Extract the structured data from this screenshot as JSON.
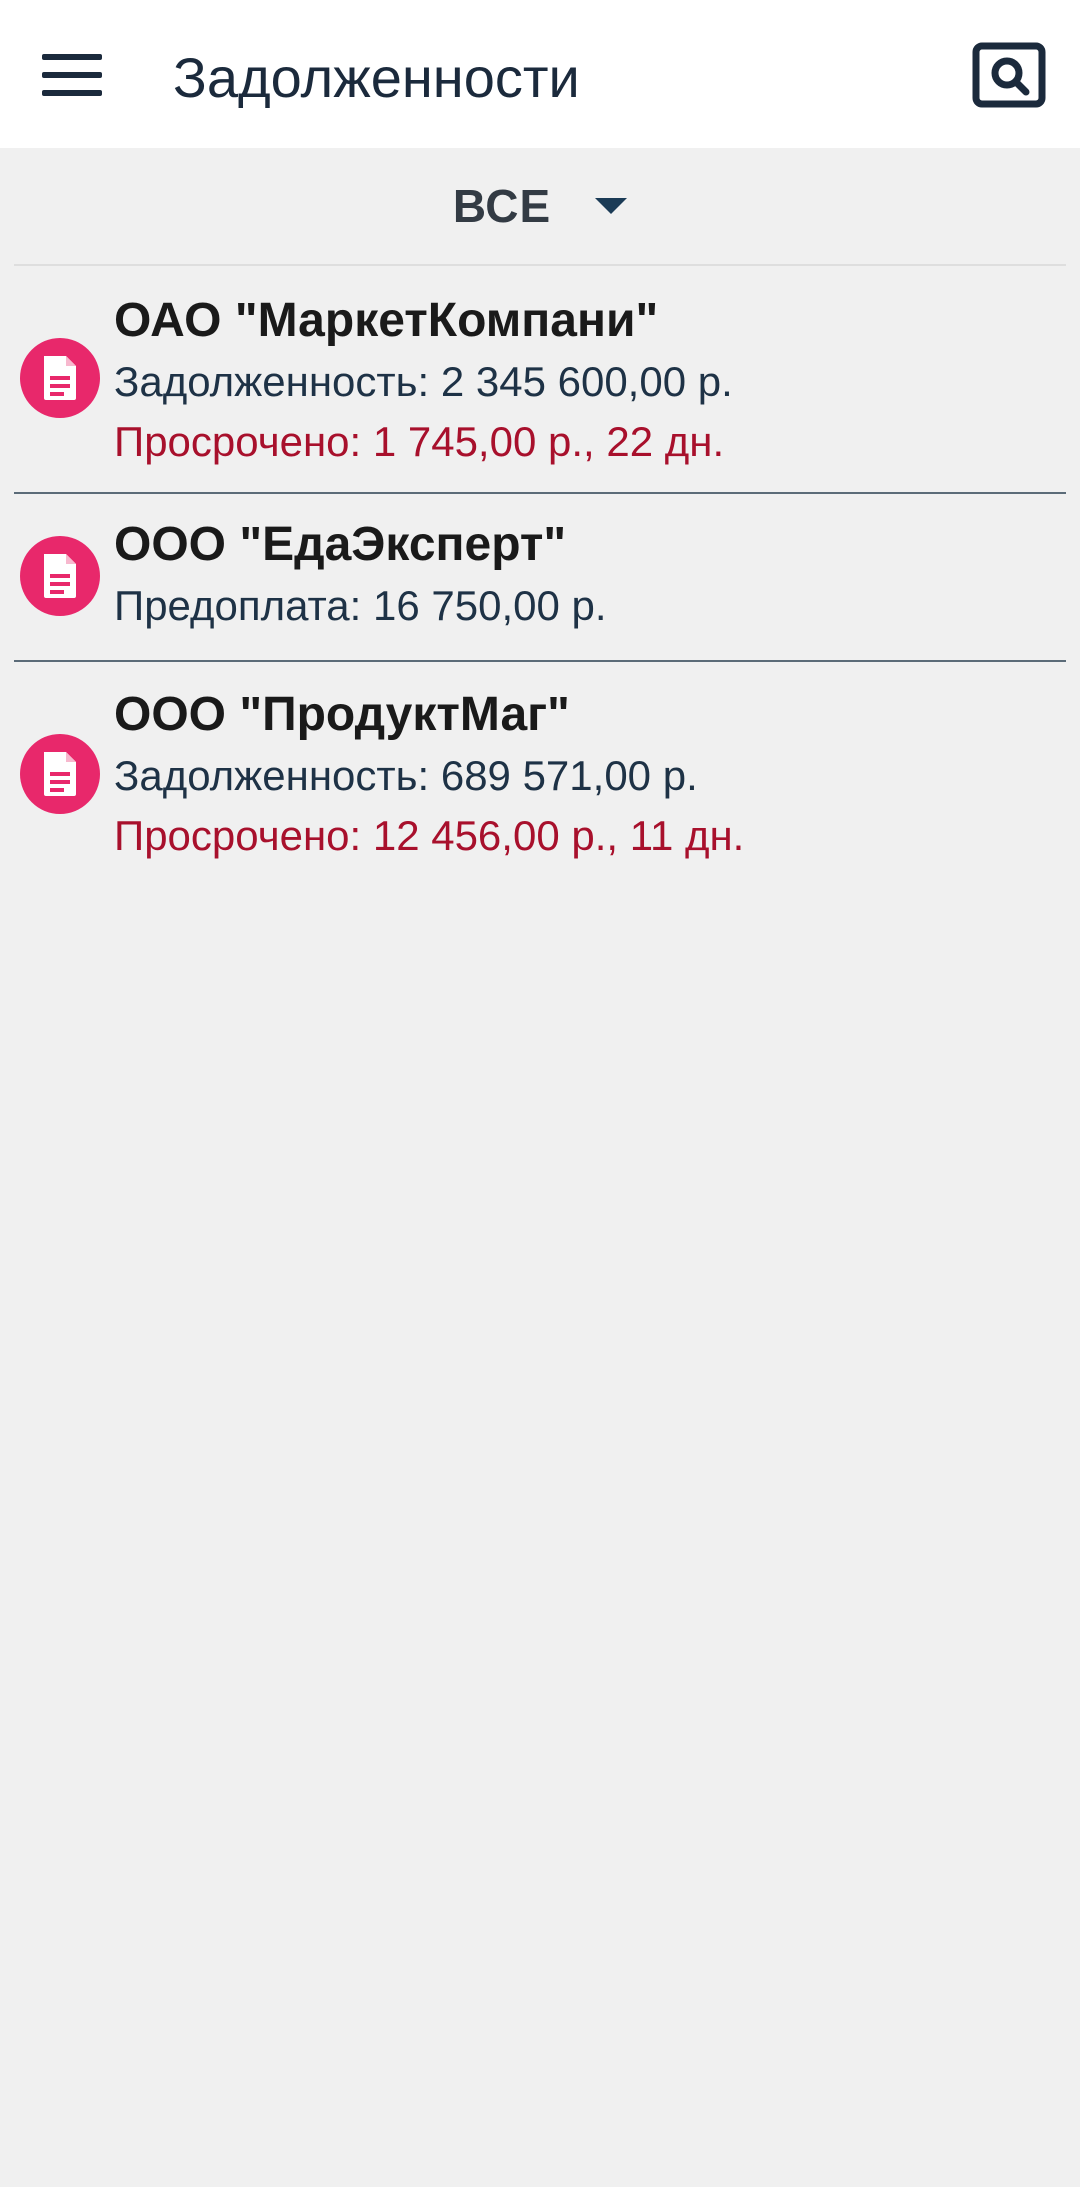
{
  "appbar": {
    "title": "Задолженности",
    "menu_icon": "hamburger-menu-icon",
    "search_icon": "search-icon"
  },
  "filter": {
    "selected": "ВСЕ"
  },
  "colors": {
    "accent": "#e8286b",
    "overdue": "#a8102c",
    "title": "#1b2a3c"
  },
  "items": [
    {
      "name": "ОАО \"МаркетКомпани\"",
      "line": "Задолженность: 2 345 600,00 р.",
      "overdue": "Просрочено: 1 745,00 р., 22 дн."
    },
    {
      "name": "ООО \"ЕдаЭксперт\"",
      "line": "Предоплата: 16 750,00 р."
    },
    {
      "name": "ООО \"ПродуктМаг\"",
      "line": "Задолженность: 689 571,00 р.",
      "overdue": "Просрочено: 12 456,00 р., 11 дн."
    }
  ]
}
